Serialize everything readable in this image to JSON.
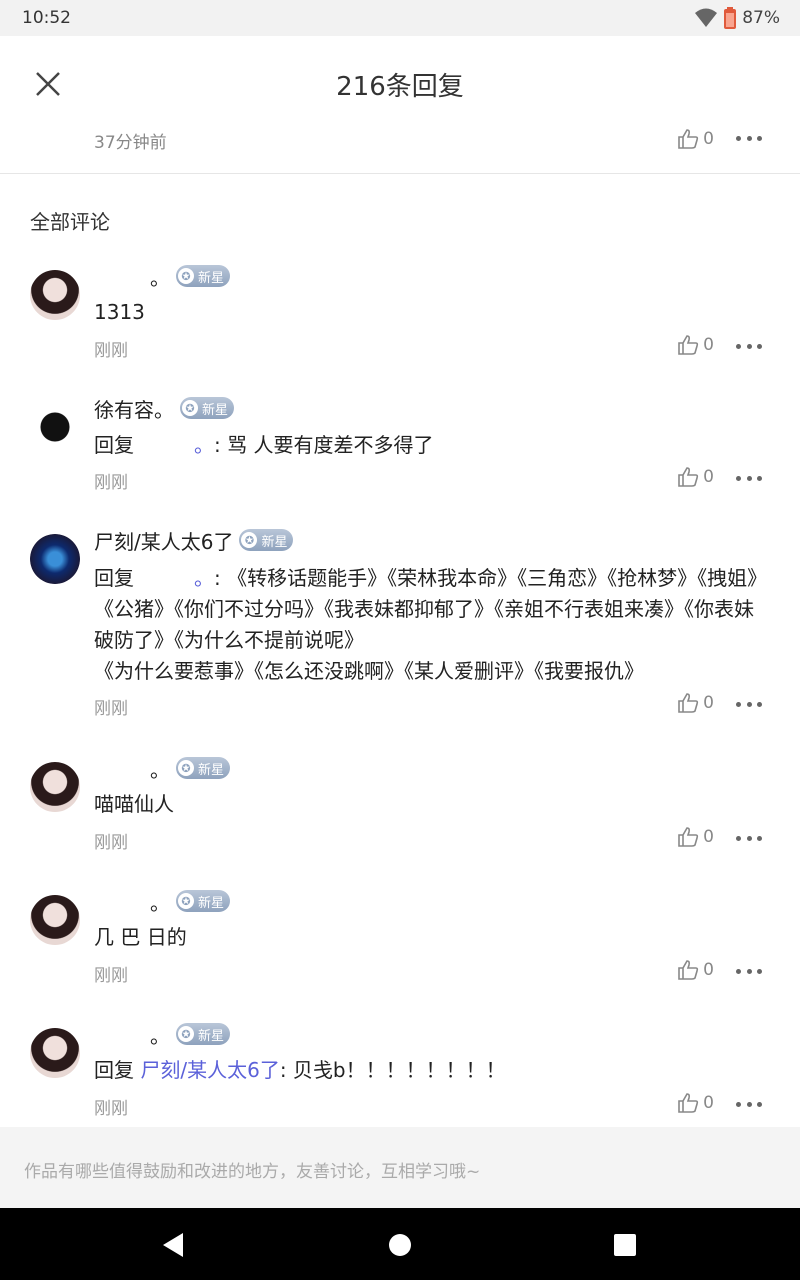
{
  "status_bar": {
    "time": "10:52",
    "battery": "87%"
  },
  "header": {
    "title": "216条回复"
  },
  "top_comment": {
    "time": "37分钟前",
    "likes": "0"
  },
  "section_title": "全部评论",
  "badge_label": "新星",
  "comments": [
    {
      "name": "。",
      "reply_prefix": "",
      "reply_target": "",
      "body": "1313",
      "time": "刚刚",
      "likes": "0"
    },
    {
      "name": "徐有容。",
      "reply_prefix": "回复",
      "reply_target": "。",
      "body": ": 骂 人要有度差不多得了",
      "time": "刚刚",
      "likes": "0"
    },
    {
      "name": "尸刻/某人太6了",
      "reply_prefix": "回复",
      "reply_target": "。",
      "body": ": 《转移话题能手》《荣林我本命》《三角恋》《抢林梦》《拽姐》《公猪》《你们不过分吗》《我表妹都抑郁了》《亲姐不行表姐来凑》《你表妹破防了》《为什么不提前说呢》",
      "body2": "《为什么要惹事》《怎么还没跳啊》《某人爱删评》《我要报仇》",
      "time": "刚刚",
      "likes": "0"
    },
    {
      "name": "。",
      "reply_prefix": "",
      "reply_target": "",
      "body": "喵喵仙人",
      "time": "刚刚",
      "likes": "0"
    },
    {
      "name": "。",
      "reply_prefix": "",
      "reply_target": "",
      "body": "几 巴 日的",
      "time": "刚刚",
      "likes": "0"
    },
    {
      "name": "。",
      "reply_prefix": "回复",
      "reply_target": "尸刻/某人太6了",
      "body": ": 贝戋b！！！！！！！！",
      "time": "刚刚",
      "likes": "0"
    }
  ],
  "footer": {
    "placeholder": "作品有哪些值得鼓励和改进的地方，友善讨论，互相学习哦~"
  },
  "colors": {
    "link": "#5b61d9",
    "badge": "#8ea2bd"
  }
}
